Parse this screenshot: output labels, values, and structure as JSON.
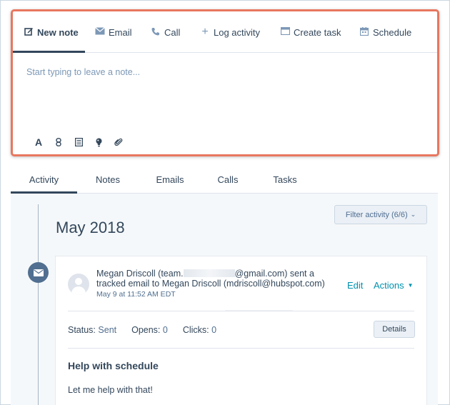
{
  "composer": {
    "tabs": [
      {
        "label": "New note",
        "icon": "edit-icon"
      },
      {
        "label": "Email",
        "icon": "envelope-icon"
      },
      {
        "label": "Call",
        "icon": "phone-icon"
      },
      {
        "label": "Log activity",
        "icon": "plus-icon"
      },
      {
        "label": "Create task",
        "icon": "task-icon"
      },
      {
        "label": "Schedule",
        "icon": "calendar-icon"
      }
    ],
    "placeholder": "Start typing to leave a note...",
    "toolbar": [
      "text-format-icon",
      "link-icon",
      "snippet-icon",
      "insert-idea-icon",
      "attachment-icon"
    ],
    "border_color": "#e8775f"
  },
  "feed": {
    "tabs": [
      "Activity",
      "Notes",
      "Emails",
      "Calls",
      "Tasks"
    ],
    "active_tab": "Activity",
    "filter_label": "Filter activity (6/6)",
    "month": "May 2018"
  },
  "email_event": {
    "sender_name": "Megan Driscoll",
    "sender_prefix": "(team.",
    "sender_suffix": "@gmail.com)",
    "action_text": "sent a",
    "line2_prefix": "tracked email to",
    "recipient_name": "Megan Driscoll",
    "recipient_email": "(mdriscoll@hubspot.com)",
    "timestamp": "May 9 at 11:52 AM EDT",
    "edit_label": "Edit",
    "actions_label": "Actions",
    "status_label": "Status:",
    "status_value": "Sent",
    "opens_label": "Opens:",
    "opens_value": "0",
    "clicks_label": "Clicks:",
    "clicks_value": "0",
    "details_label": "Details",
    "subject": "Help with schedule",
    "body": "Let me help with that!"
  },
  "colors": {
    "accent_link": "#0091ae",
    "text_primary": "#33475b",
    "feed_bg": "#f5f8fa",
    "timeline_icon_bg": "#516f90"
  }
}
